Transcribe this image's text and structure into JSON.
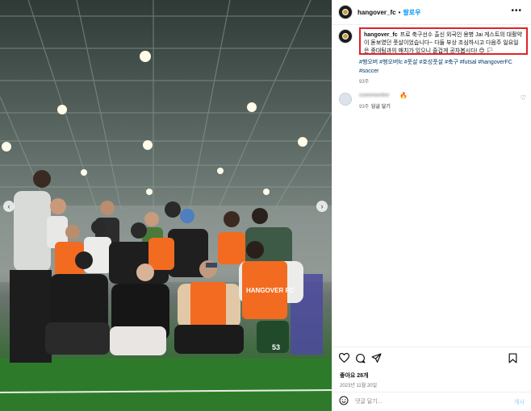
{
  "post": {
    "username": "hangover_fc",
    "follow_label": "팔로우",
    "separator": "•",
    "more_label": "•••",
    "caption_username": "hangover_fc",
    "caption_text": "프로 축구선수 출신 외국인 용병 Jai 게스트의 대활약이 돋보였던 풋살이었습니다~ 다들 부상 조심하시고 다음주 일요일은 중대팀과의 매치가 있으니 즐겁게 공차봅시다! 😊 🏳",
    "hashtags": "#행오버 #행오버fc #풋살 #호성풋살 #축구 #futsal #hangoverFC #soccer",
    "post_age": "93주"
  },
  "comment": {
    "username": "commenter",
    "emoji": "🔥",
    "age": "93주",
    "reply_label": "답글 달기"
  },
  "footer": {
    "likes": "좋아요 28개",
    "date": "2023년 11월 20일",
    "comment_placeholder": "댓글 달기...",
    "post_label": "게시"
  },
  "photo": {
    "nav_prev": "‹",
    "nav_next": "›",
    "jersey_text": "HANGOVER FC",
    "jersey_number": "53"
  },
  "colors": {
    "follow_blue": "#0095f6",
    "highlight_red": "#e0232a",
    "turf_green": "#2f7a2c",
    "bib_orange": "#f26b21"
  },
  "icons": {
    "like": "heart-icon",
    "comment": "comment-bubble-icon",
    "share": "paper-plane-icon",
    "save": "bookmark-icon",
    "emoji": "smile-icon"
  }
}
